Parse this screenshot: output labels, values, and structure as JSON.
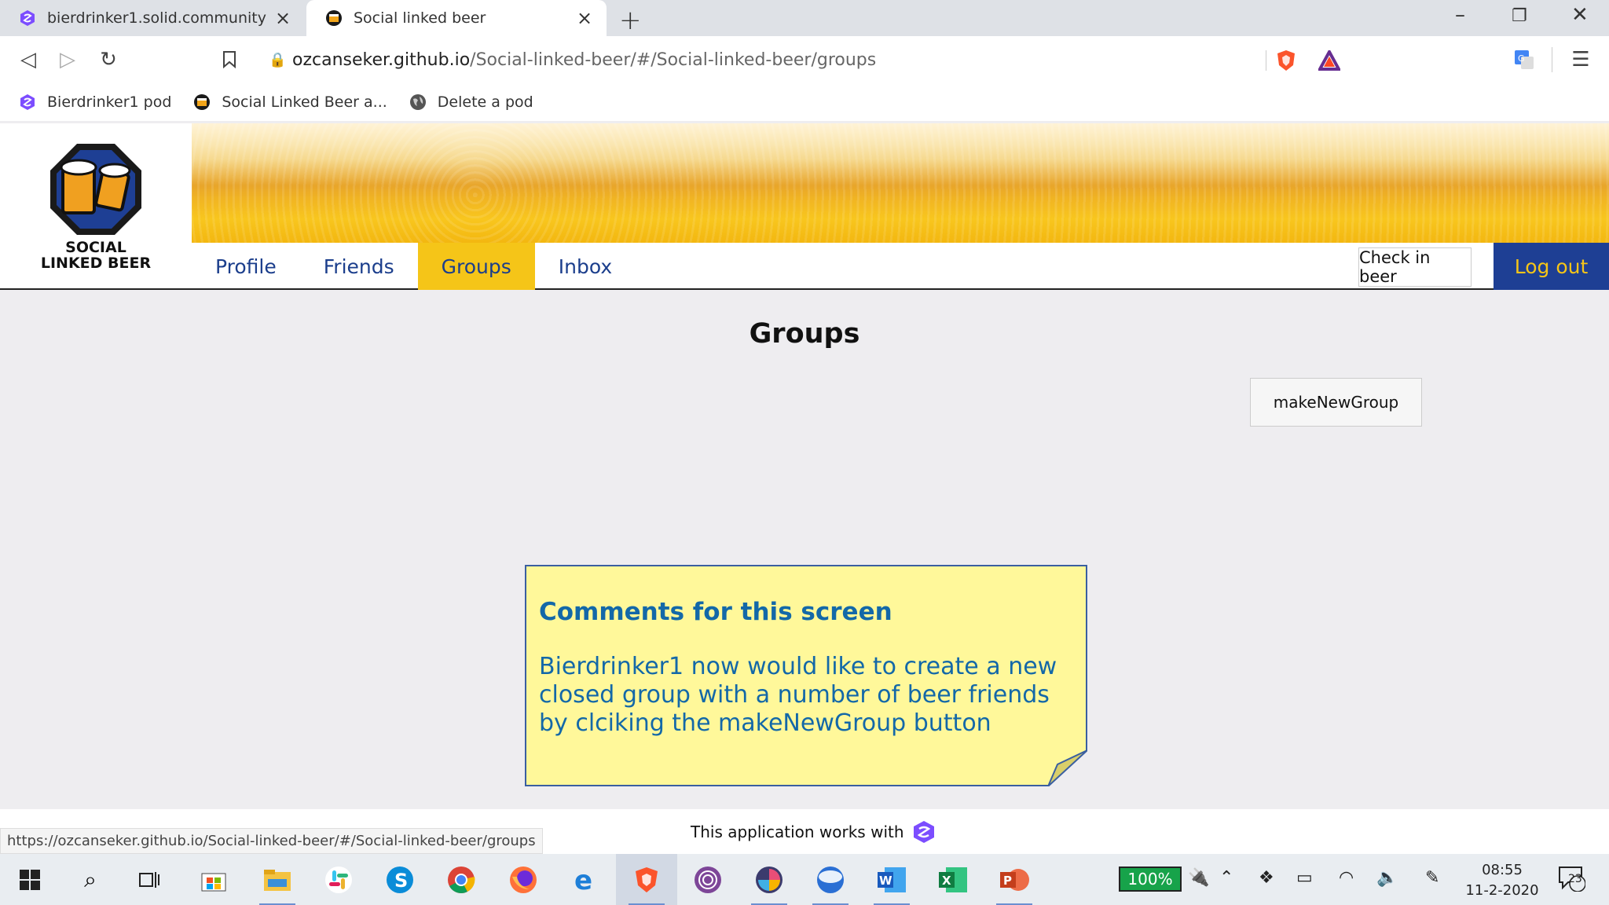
{
  "browser": {
    "tabs": [
      {
        "title": "bierdrinker1.solid.community",
        "active": false
      },
      {
        "title": "Social linked beer",
        "active": true
      }
    ],
    "url_host": "ozcanseker.github.io",
    "url_path": "/Social-linked-beer/#/Social-linked-beer/groups",
    "bookmarks": [
      "Bierdrinker1 pod",
      "Social Linked Beer a...",
      "Delete a pod"
    ],
    "status_url": "https://ozcanseker.github.io/Social-linked-beer/#/Social-linked-beer/groups"
  },
  "app": {
    "logo_text_line1": "SOCIAL",
    "logo_text_line2": "LINKED BEER",
    "menu": [
      "Profile",
      "Friends",
      "Groups",
      "Inbox"
    ],
    "active_menu": "Groups",
    "check_in_label": "Check in beer",
    "logout_label": "Log out",
    "page_title": "Groups",
    "make_group_label": "makeNewGroup",
    "footer_text": "This application works with"
  },
  "note": {
    "heading": "Comments for this screen",
    "body": "Bierdrinker1 now would like to create a new closed group with a number of beer friends by clciking the makeNewGroup button"
  },
  "taskbar": {
    "battery": "100%",
    "time": "08:55",
    "date": "11-2-2020",
    "notifications": "23"
  },
  "colors": {
    "brand_blue": "#1e3f94",
    "brand_yellow": "#f5c518",
    "note_bg": "#fff89a",
    "note_text": "#1368a8"
  }
}
